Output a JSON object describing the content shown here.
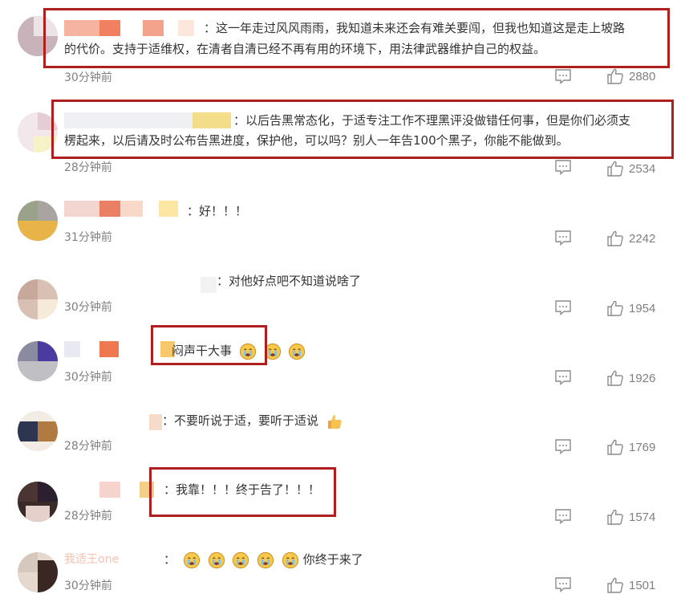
{
  "comments": [
    {
      "text_line1": "：这一年走过风风雨雨，我知道未来还会有难关要闯，但我也知道这是走上坡路",
      "text_line2": "的代价。支持于适维权，在清者自清已经不再有用的环境下，用法律武器维护自己的权益。",
      "time": "30分钟前",
      "likes": "2880"
    },
    {
      "text_line1": "：以后告黑常态化，于适专注工作不理黑评没做错任何事，但是你们必须支",
      "text_line2": "楞起来，以后请及时公布告黑进度，保护他，可以吗？别人一年告100个黑子，你能不能做到。",
      "time": "28分钟前",
      "likes": "2534"
    },
    {
      "text": "：好！！！",
      "time": "31分钟前",
      "likes": "2242"
    },
    {
      "text": "：对他好点吧不知道说啥了",
      "time": "30分钟前",
      "likes": "1954"
    },
    {
      "text": "闷声干大事",
      "time": "30分钟前",
      "likes": "1926"
    },
    {
      "text": "：不要听说于适，要听于适说",
      "time": "28分钟前",
      "likes": "1769"
    },
    {
      "text": "：我靠！！！终于告了！！！",
      "time": "28分钟前",
      "likes": "1574"
    },
    {
      "name": "我适王one",
      "text": "你终于来了",
      "colon": "：",
      "time": "30分钟前",
      "likes": "1501"
    }
  ],
  "icons": {
    "reply": "comment-icon",
    "like": "thumbs-up-icon",
    "emoji_cry": "crying-face-emoji",
    "emoji_thumb": "thumbs-up-emoji"
  },
  "colors": {
    "highlight_box": "#b01e1e",
    "meta_text": "#808080",
    "body_text": "#333333"
  }
}
